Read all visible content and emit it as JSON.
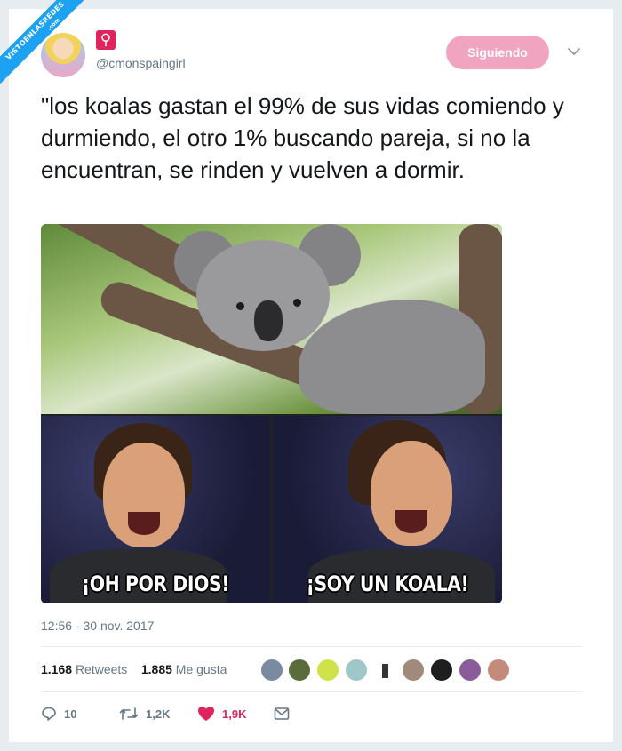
{
  "watermark": {
    "line1": "VISTOENLASREDES",
    "line2": ".com"
  },
  "author": {
    "emoji_icon": "venus-symbol",
    "emoji_char": "♀",
    "handle": "@cmonspaingirl"
  },
  "follow_button": {
    "label": "Siguiendo",
    "color": "#f0a4c0"
  },
  "tweet": {
    "text": "\"los koalas gastan el 99% de sus vidas comiendo y durmiendo, el otro 1% buscando pareja, si no la encuentran, se rinden y vuelven a dormir.",
    "timestamp": "12:56 - 30 nov. 2017"
  },
  "media": {
    "caption_left": "¡OH POR DIOS!",
    "caption_right": "¡SOY UN KOALA!"
  },
  "stats": {
    "retweets_count": "1.168",
    "retweets_label": "Retweets",
    "likes_count": "1.885",
    "likes_label": "Me gusta"
  },
  "actions": {
    "reply_count": "10",
    "retweet_count": "1,2K",
    "like_count": "1,9K"
  },
  "colors": {
    "accent": "#1da1f2",
    "like": "#e0245e",
    "muted": "#657786"
  }
}
